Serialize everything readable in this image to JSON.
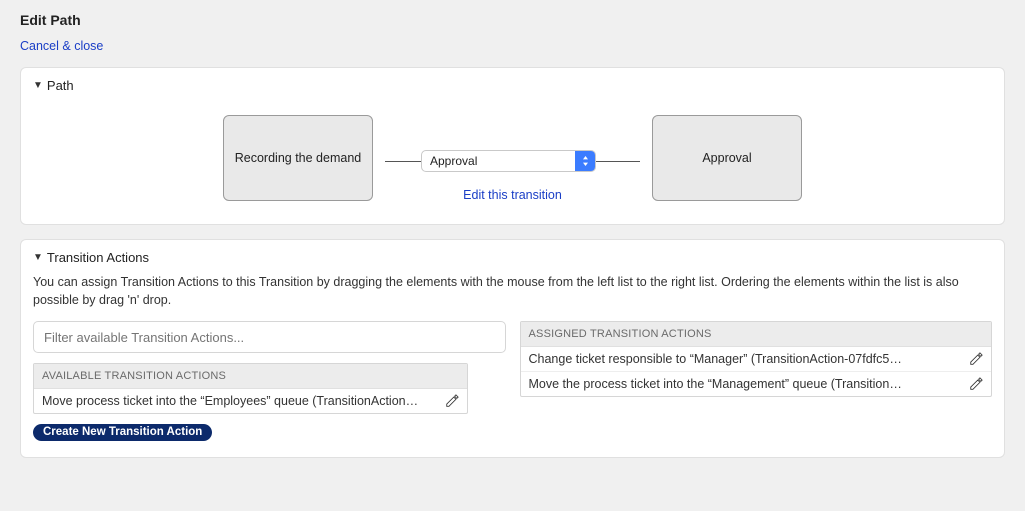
{
  "page": {
    "title": "Edit Path",
    "cancel_label": "Cancel & close"
  },
  "path_panel": {
    "header": "Path",
    "from_state": "Recording the demand",
    "transition_selected": "Approval",
    "to_state": "Approval",
    "edit_transition_label": "Edit this transition"
  },
  "actions_panel": {
    "header": "Transition Actions",
    "help": "You can assign Transition Actions to this Transition by dragging the elements with the mouse from the left list to the right list. Ordering the elements within the list is also possible by drag 'n' drop.",
    "filter_placeholder": "Filter available Transition Actions...",
    "available_header": "AVAILABLE TRANSITION ACTIONS",
    "assigned_header": "ASSIGNED TRANSITION ACTIONS",
    "available": [
      {
        "label": "Move process ticket into the “Employees” queue (TransitionAction…"
      }
    ],
    "assigned": [
      {
        "label": "Change ticket responsible to “Manager” (TransitionAction-07fdfc5…"
      },
      {
        "label": "Move the process ticket into the “Management” queue (Transition…"
      }
    ],
    "create_new_label": "Create New Transition Action"
  }
}
